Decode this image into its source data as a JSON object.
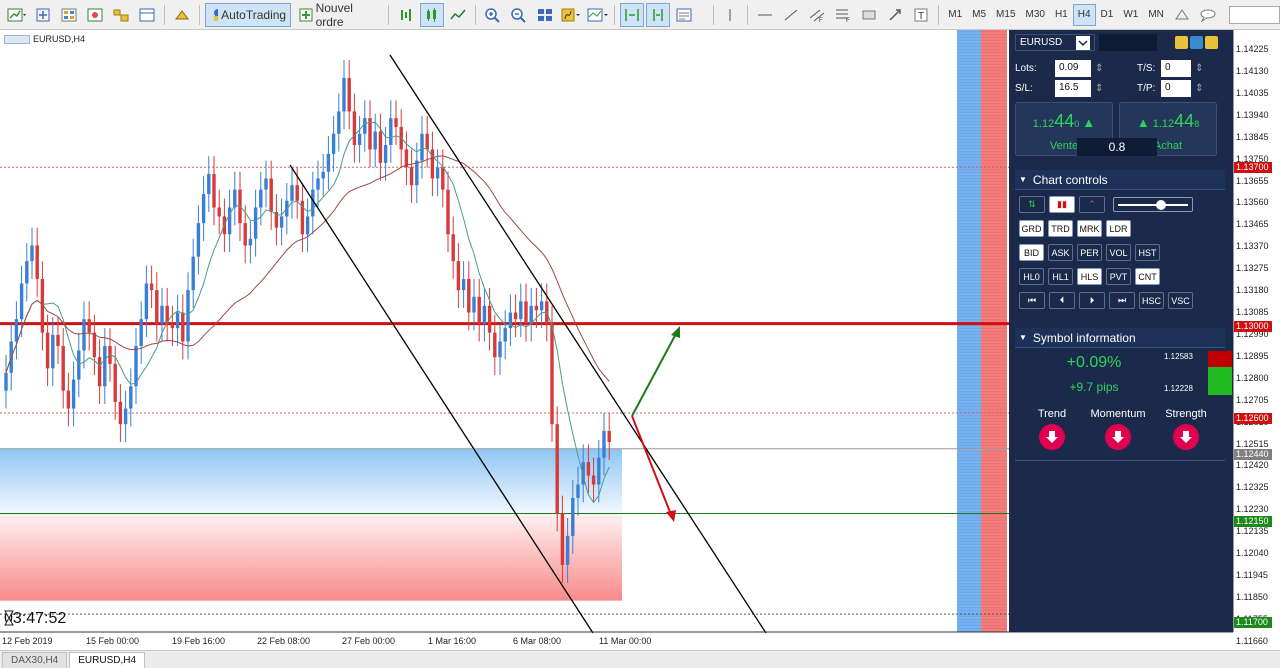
{
  "toolbar": {
    "autotrading_label": "AutoTrading",
    "new_order_label": "Nouvel ordre",
    "timeframes": [
      "M1",
      "M5",
      "M15",
      "M30",
      "H1",
      "H4",
      "D1",
      "W1",
      "MN"
    ],
    "active_timeframe": "H4"
  },
  "chart": {
    "symbol_label": "EURUSD,H4",
    "timer": "03:47:52",
    "price_axis": [
      "1.14225",
      "1.14130",
      "1.14035",
      "1.13940",
      "1.13845",
      "1.13750",
      "1.13655",
      "1.13560",
      "1.13465",
      "1.13370",
      "1.13275",
      "1.13180",
      "1.13085",
      "1.12990",
      "1.12895",
      "1.12800",
      "1.12705",
      "1.12610",
      "1.12515",
      "1.12420",
      "1.12325",
      "1.12230",
      "1.12135",
      "1.12040",
      "1.11945",
      "1.11850",
      "1.11755",
      "1.11660"
    ],
    "price_tags": [
      {
        "text": "1.13700",
        "color": "#d01010"
      },
      {
        "text": "1.13000",
        "color": "#d01010"
      },
      {
        "text": "1.12600",
        "color": "#d01010"
      },
      {
        "text": "1.12440",
        "color": "#808080"
      },
      {
        "text": "1.12150",
        "color": "#1a8a1a"
      },
      {
        "text": "1.11700",
        "color": "#1a8a1a"
      }
    ],
    "dates": [
      "12 Feb 2019",
      "15 Feb 00:00",
      "19 Feb 16:00",
      "22 Feb 08:00",
      "27 Feb 00:00",
      "1 Mar 16:00",
      "6 Mar 08:00",
      "11 Mar 00:00"
    ]
  },
  "panel": {
    "symbol": "EURUSD",
    "lots_label": "Lots:",
    "lots_value": "0.09",
    "sl_label": "S/L:",
    "sl_value": "16.5",
    "ts_label": "T/S:",
    "ts_value": "0",
    "tp_label": "T/P:",
    "tp_value": "0",
    "sell_price_prefix": "1.12",
    "sell_price_big": "44",
    "sell_price_sup": "0",
    "sell_label": "Vente",
    "buy_price_prefix": "1.12",
    "buy_price_big": "44",
    "buy_price_sup": "8",
    "buy_label": "Achat",
    "spread": "0.8",
    "chart_controls_title": "Chart controls",
    "cc_row1": [
      "GRD",
      "TRD",
      "MRK",
      "LDR"
    ],
    "cc_row2": [
      "BID",
      "ASK",
      "PER",
      "VOL",
      "HST"
    ],
    "cc_row3": [
      "HL0",
      "HL1",
      "HLS",
      "PVT",
      "CNT"
    ],
    "cc_row4_extra": [
      "HSC",
      "VSC"
    ],
    "symbol_info_title": "Symbol information",
    "change_pct": "+0.09%",
    "change_pips": "+9.7 pips",
    "high": "1.12583",
    "low": "1.12228",
    "indicators": [
      "Trend",
      "Momentum",
      "Strength"
    ]
  },
  "tabs": [
    "DAX30,H4",
    "EURUSD,H4"
  ],
  "active_tab": "EURUSD,H4"
}
